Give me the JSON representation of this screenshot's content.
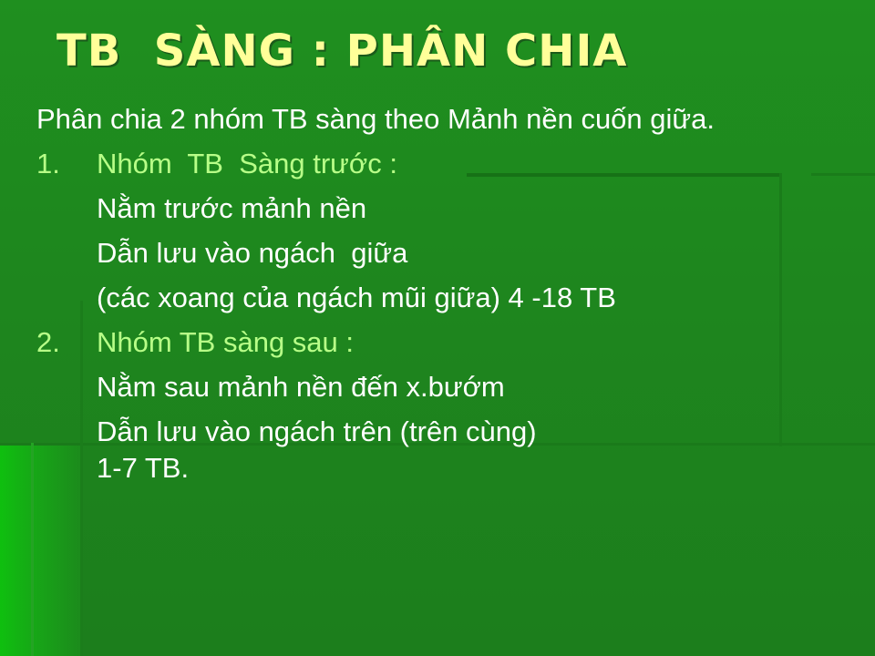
{
  "slide": {
    "title": "TB  SÀNG : PHÂN CHIA",
    "intro": "Phân chia 2 nhóm TB sàng theo Mảnh nền cuốn giữa.",
    "groups": [
      {
        "number": "1.",
        "heading": "Nhóm  TB  Sàng trước :",
        "lines": [
          "Nằm trước mảnh nền",
          "Dẫn lưu vào ngách  giữa",
          "(các xoang của ngách mũi giữa) 4 -18 TB"
        ]
      },
      {
        "number": "2.",
        "heading": "Nhóm TB sàng sau :",
        "lines": [
          "Nằm sau mảnh nền đến x.bướm",
          "Dẫn lưu vào ngách trên (trên cùng)",
          "1-7 TB."
        ]
      }
    ]
  },
  "colors": {
    "background": "#1f8a1f",
    "title": "#ffff99",
    "heading": "#b8ff88",
    "text": "#ffffff"
  }
}
